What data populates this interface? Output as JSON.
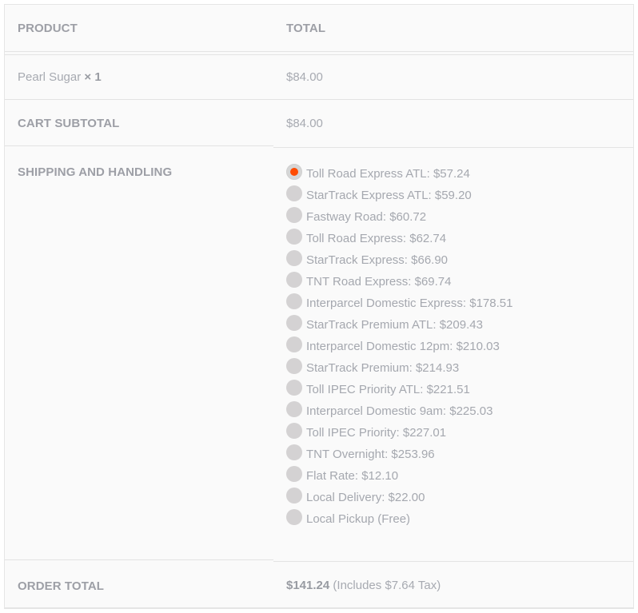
{
  "headers": {
    "product": "PRODUCT",
    "total": "TOTAL"
  },
  "line_item": {
    "name": "Pearl Sugar",
    "qty": "× 1",
    "total": "$84.00"
  },
  "subtotal": {
    "label": "CART SUBTOTAL",
    "value": "$84.00"
  },
  "shipping": {
    "label": "SHIPPING AND HANDLING",
    "selected_index": 0,
    "options": [
      "Toll Road Express ATL: $57.24",
      "StarTrack Express ATL: $59.20",
      "Fastway Road: $60.72",
      "Toll Road Express: $62.74",
      "StarTrack Express: $66.90",
      "TNT Road Express: $69.74",
      "Interparcel Domestic Express: $178.51",
      "StarTrack Premium ATL: $209.43",
      "Interparcel Domestic 12pm: $210.03",
      "StarTrack Premium: $214.93",
      "Toll IPEC Priority ATL: $221.51",
      "Interparcel Domestic 9am: $225.03",
      "Toll IPEC Priority: $227.01",
      "TNT Overnight: $253.96",
      "Flat Rate: $12.10",
      "Local Delivery: $22.00",
      "Local Pickup (Free)"
    ]
  },
  "order_total": {
    "label": "ORDER TOTAL",
    "amount": "$141.24",
    "tax_note": "(Includes $7.64 Tax)"
  },
  "colors": {
    "accent": "#ff4b00",
    "text": "#a3a6ad",
    "background": "#fafafa",
    "border": "#e3e3e3"
  }
}
